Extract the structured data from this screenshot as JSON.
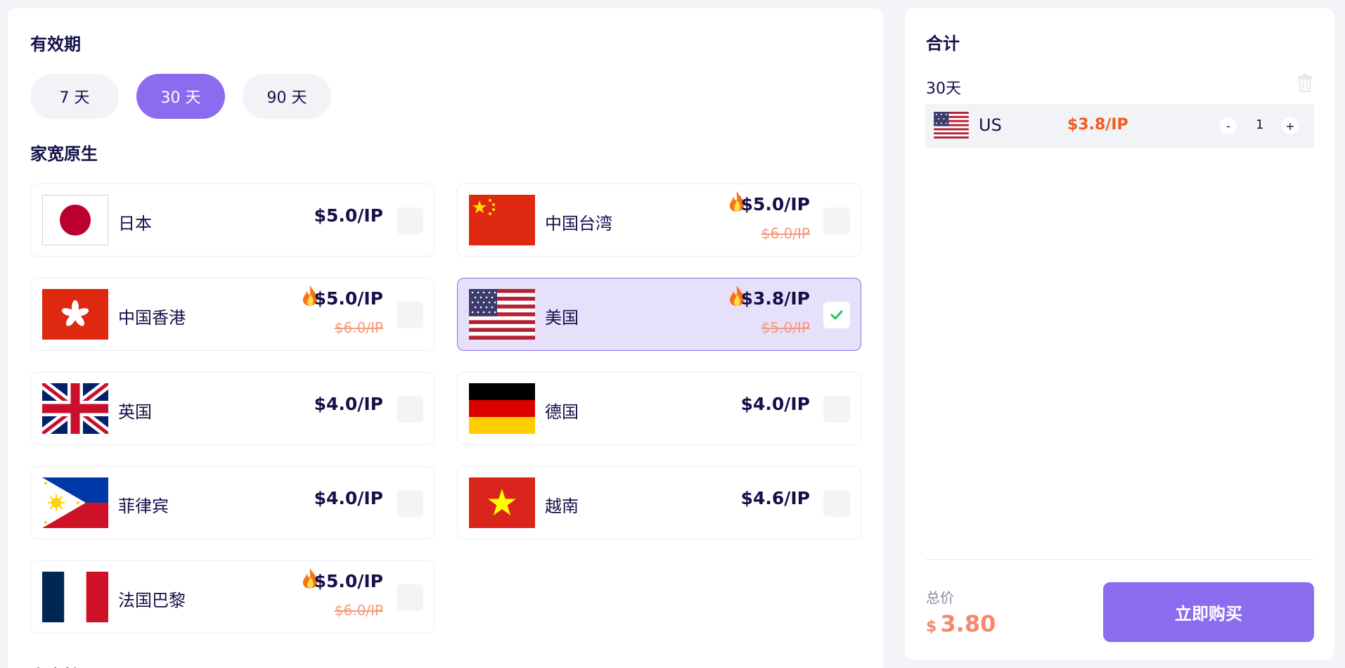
{
  "validity": {
    "title": "有效期",
    "options": [
      {
        "label": "7 天",
        "active": false
      },
      {
        "label": "30 天",
        "active": true
      },
      {
        "label": "90 天",
        "active": false
      }
    ]
  },
  "home_native": {
    "title": "家宽原生",
    "items": [
      {
        "name": "日本",
        "price": "$5.0/IP",
        "flag": "japan-flag-icon",
        "checked": false
      },
      {
        "name": "中国台湾",
        "price": "$5.0/IP",
        "old_price": "$6.0/IP",
        "hot": true,
        "flag": "china-flag-icon",
        "checked": false
      },
      {
        "name": "中国香港",
        "price": "$5.0/IP",
        "old_price": "$6.0/IP",
        "hot": true,
        "flag": "hongkong-flag-icon",
        "checked": false
      },
      {
        "name": "美国",
        "price": "$3.8/IP",
        "old_price": "$5.0/IP",
        "hot": true,
        "flag": "usa-flag-icon",
        "checked": true
      },
      {
        "name": "英国",
        "price": "$4.0/IP",
        "flag": "uk-flag-icon",
        "checked": false
      },
      {
        "name": "德国",
        "price": "$4.0/IP",
        "flag": "germany-flag-icon",
        "checked": false
      },
      {
        "name": "菲律宾",
        "price": "$4.0/IP",
        "flag": "philippines-flag-icon",
        "checked": false
      },
      {
        "name": "越南",
        "price": "$4.6/IP",
        "flag": "vietnam-flag-icon",
        "checked": false
      },
      {
        "name": "法国巴黎",
        "price": "$5.0/IP",
        "old_price": "$6.0/IP",
        "hot": true,
        "flag": "france-flag-icon",
        "checked": false
      }
    ]
  },
  "home_dial": {
    "title": "家宽拨号"
  },
  "summary": {
    "title": "合计",
    "period": "30天",
    "cart": [
      {
        "country": "US",
        "price": "$3.8/IP",
        "qty_minus": "-",
        "qty": "1",
        "qty_plus": "+"
      }
    ],
    "total_label": "总价",
    "total_currency": "$",
    "total_value": "3.80",
    "buy_label": "立即购买"
  },
  "colors": {
    "accent": "#8b6cef",
    "price_orange": "#f25a1d",
    "old_price": "#f59a7a",
    "selected_bg": "#e6e0fb",
    "check_green": "#22c55e"
  }
}
